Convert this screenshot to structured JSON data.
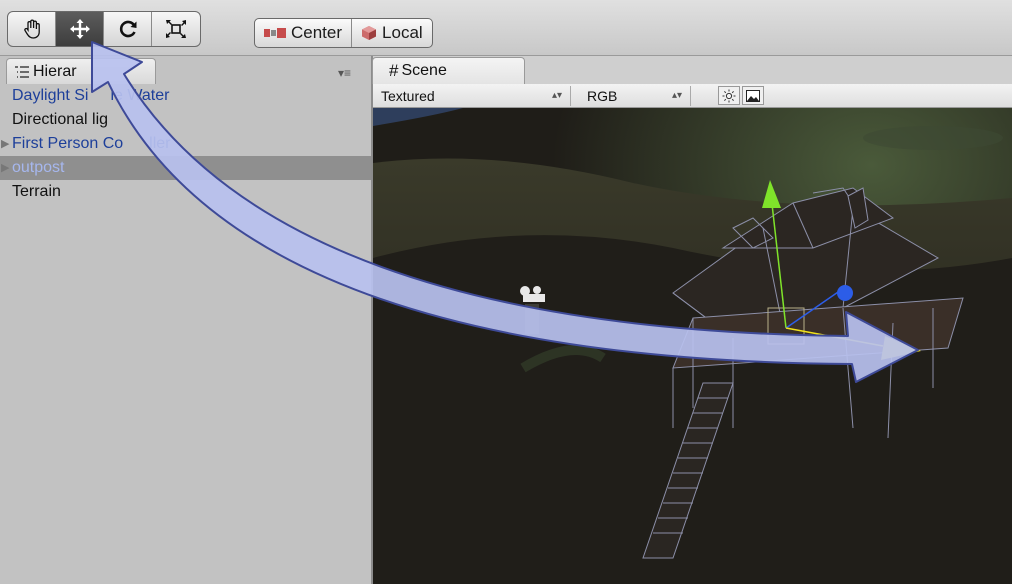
{
  "toolbar": {
    "tools": [
      "hand-tool",
      "move-tool",
      "rotate-tool",
      "scale-tool"
    ],
    "active_tool": "move-tool",
    "pivot_label": "Center",
    "space_label": "Local"
  },
  "hierarchy": {
    "tab_label": "Hierar",
    "items": [
      {
        "label": "Daylight Si",
        "label_tail": "le Water",
        "color": "#1d3f9a"
      },
      {
        "label": "Directional lig",
        "color": "#111111"
      },
      {
        "label": "First Person Co",
        "label_tail": "ller",
        "color": "#1d3f9a"
      },
      {
        "label": "outpost",
        "color": "#8ea2e0"
      },
      {
        "label": "Terrain",
        "color": "#111111"
      }
    ]
  },
  "scene": {
    "tab_label": "Scene",
    "render_mode": "Textured",
    "color_mode": "RGB"
  },
  "colors": {
    "arrow_fill": "#b8c1ef",
    "arrow_stroke": "#3e4a98",
    "gizmo_y": "#7fe32a",
    "gizmo_x": "#f0e21a",
    "gizmo_z": "#2c5de8"
  }
}
